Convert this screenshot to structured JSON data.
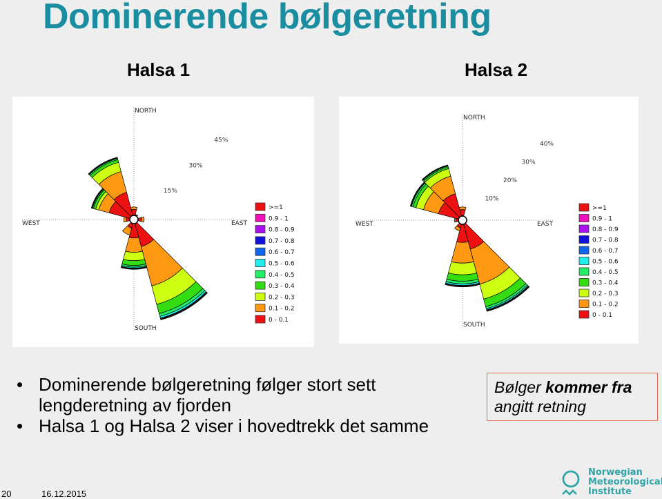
{
  "title": "Dominerende bølgeretning",
  "subtitles": [
    "Halsa 1",
    "Halsa 2"
  ],
  "bullets": [
    "Dominerende bølgeretning følger stort sett lengderetning av fjorden",
    "Halsa 1 og Halsa 2 viser i hovedtrekk det samme"
  ],
  "note": {
    "italic_part": "Bølger ",
    "bold_part": "kommer fra",
    "rest": "angitt retning"
  },
  "footer": {
    "page_number": "20",
    "date": "16.12.2015"
  },
  "logo": {
    "lines": [
      "Norwegian",
      "Meteorological",
      "Institute"
    ]
  },
  "chart_data": [
    {
      "type": "wind_rose",
      "title": "Halsa 1",
      "directions_label": {
        "north": "NORTH",
        "south": "SOUTH",
        "east": "EAST",
        "west": "WEST"
      },
      "rings": [
        15,
        30,
        45
      ],
      "ring_labels": [
        "15%",
        "30%",
        "45%"
      ],
      "max_radius_pct": 45,
      "legend": [
        {
          "label": ">=1",
          "color": "#ee1111"
        },
        {
          "label": "0.9 - 1",
          "color": "#ee11bb"
        },
        {
          "label": "0.8 - 0.9",
          "color": "#aa11ee"
        },
        {
          "label": "0.7 - 0.8",
          "color": "#1111dd"
        },
        {
          "label": "0.6 - 0.7",
          "color": "#1166ee"
        },
        {
          "label": "0.5 - 0.6",
          "color": "#22eeee"
        },
        {
          "label": "0.4 - 0.5",
          "color": "#22ee66"
        },
        {
          "label": "0.3 - 0.4",
          "color": "#33dd11"
        },
        {
          "label": "0.2 - 0.3",
          "color": "#ccff11"
        },
        {
          "label": "0.1 - 0.2",
          "color": "#ff9911"
        },
        {
          "label": "0 - 0.1",
          "color": "#ee1111"
        }
      ],
      "band_colors": [
        "#ee1111",
        "#ff9911",
        "#ccff11",
        "#33dd11",
        "#22ee66",
        "#22eeee",
        "#111111"
      ],
      "sectors": [
        {
          "dir": 0,
          "bands": [
            2.5,
            1.0
          ]
        },
        {
          "dir": 30,
          "bands": [
            0.5
          ]
        },
        {
          "dir": 90,
          "bands": [
            1.5,
            1.0
          ]
        },
        {
          "dir": 150,
          "bands": [
            10,
            17,
            8,
            4,
            1.2,
            0.8,
            0.7
          ]
        },
        {
          "dir": 180,
          "bands": [
            6,
            6,
            3.5,
            2,
            0.7,
            0.4,
            0.5
          ]
        },
        {
          "dir": 210,
          "bands": [
            2,
            3
          ]
        },
        {
          "dir": 270,
          "bands": [
            1.5,
            1.0
          ]
        },
        {
          "dir": 300,
          "bands": [
            9,
            4.5,
            1.3,
            1.0,
            0.4,
            0,
            0.5
          ]
        },
        {
          "dir": 330,
          "bands": [
            10,
            9,
            4,
            1.2,
            0.5,
            0,
            0.5
          ]
        }
      ]
    },
    {
      "type": "wind_rose",
      "title": "Halsa 2",
      "directions_label": {
        "north": "NORTH",
        "south": "SOUTH",
        "east": "EAST",
        "west": "WEST"
      },
      "rings": [
        10,
        20,
        30,
        40
      ],
      "ring_labels": [
        "10%",
        "20%",
        "30%",
        "40%"
      ],
      "max_radius_pct": 40,
      "legend": [
        {
          "label": ">=1",
          "color": "#ee1111"
        },
        {
          "label": "0.9 - 1",
          "color": "#ee11bb"
        },
        {
          "label": "0.8 - 0.9",
          "color": "#aa11ee"
        },
        {
          "label": "0.7 - 0.8",
          "color": "#1111dd"
        },
        {
          "label": "0.6 - 0.7",
          "color": "#1166ee"
        },
        {
          "label": "0.5 - 0.6",
          "color": "#22eeee"
        },
        {
          "label": "0.4 - 0.5",
          "color": "#22ee66"
        },
        {
          "label": "0.3 - 0.4",
          "color": "#33dd11"
        },
        {
          "label": "0.2 - 0.3",
          "color": "#ccff11"
        },
        {
          "label": "0.1 - 0.2",
          "color": "#ff9911"
        },
        {
          "label": "0 - 0.1",
          "color": "#ee1111"
        }
      ],
      "band_colors": [
        "#ee1111",
        "#ff9911",
        "#ccff11",
        "#33dd11",
        "#22ee66",
        "#22eeee",
        "#111111"
      ],
      "sectors": [
        {
          "dir": 0,
          "bands": [
            2.5,
            1.0
          ]
        },
        {
          "dir": 150,
          "bands": [
            10,
            14,
            6,
            3,
            0.8,
            0.5,
            0.6
          ]
        },
        {
          "dir": 180,
          "bands": [
            7,
            8,
            4.5,
            2.5,
            1.0,
            0.6,
            0.6
          ]
        },
        {
          "dir": 210,
          "bands": [
            1.5,
            1.2
          ]
        },
        {
          "dir": 270,
          "bands": [
            1.0,
            0.5
          ]
        },
        {
          "dir": 300,
          "bands": [
            8,
            6,
            3,
            1.2,
            0.6,
            0,
            0.5
          ]
        },
        {
          "dir": 330,
          "bands": [
            9,
            7,
            3,
            0.7,
            0.4,
            0,
            0.4
          ]
        }
      ]
    }
  ]
}
